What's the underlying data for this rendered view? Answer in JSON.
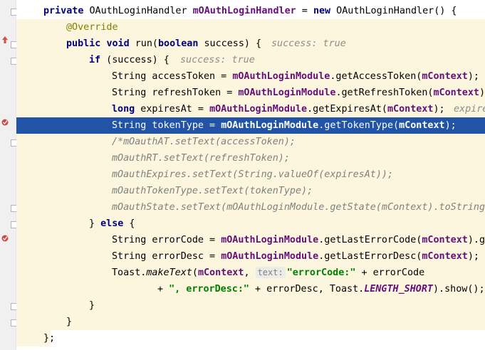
{
  "editor": {
    "lines": [
      {
        "id": 0,
        "segments": [
          {
            "t": "private",
            "c": "kw"
          },
          {
            "t": " OAuthLoginHandler "
          },
          {
            "t": "mOAuthLoginHandler",
            "c": "field"
          },
          {
            "t": " = "
          },
          {
            "t": "new",
            "c": "kw"
          },
          {
            "t": " OAuthLoginHandler() {"
          }
        ]
      },
      {
        "id": 1,
        "segments": [
          {
            "t": "@Override",
            "c": "ann"
          }
        ]
      },
      {
        "id": 2,
        "segments": [
          {
            "t": "public",
            "c": "kw"
          },
          {
            "t": " "
          },
          {
            "t": "void",
            "c": "kw"
          },
          {
            "t": " run("
          },
          {
            "t": "boolean",
            "c": "kw"
          },
          {
            "t": " success) {"
          }
        ]
      },
      {
        "id": 3,
        "segments": [
          {
            "t": "if",
            "c": "kw"
          },
          {
            "t": " (success) {"
          }
        ]
      },
      {
        "id": 4,
        "segments": [
          {
            "t": "String accessToken = "
          },
          {
            "t": "mOAuthLoginModule",
            "c": "field"
          },
          {
            "t": ".getAccessToken("
          },
          {
            "t": "mContext",
            "c": "field"
          },
          {
            "t": ");"
          }
        ]
      },
      {
        "id": 5,
        "segments": [
          {
            "t": "String refreshToken = "
          },
          {
            "t": "mOAuthLoginModule",
            "c": "field"
          },
          {
            "t": ".getRefreshToken("
          },
          {
            "t": "mContext",
            "c": "field"
          },
          {
            "t": ");"
          }
        ]
      },
      {
        "id": 6,
        "segments": [
          {
            "t": "long",
            "c": "kw"
          },
          {
            "t": " expiresAt = "
          },
          {
            "t": "mOAuthLoginModule",
            "c": "field"
          },
          {
            "t": ".getExpiresAt("
          },
          {
            "t": "mContext",
            "c": "field"
          },
          {
            "t": ");"
          }
        ]
      },
      {
        "id": 7,
        "segments": [
          {
            "t": "String tokenType = "
          },
          {
            "t": "mOAuthLoginModule",
            "c": "field"
          },
          {
            "t": ".getTokenType("
          },
          {
            "t": "mContext",
            "c": "field"
          },
          {
            "t": ");"
          }
        ]
      },
      {
        "id": 8,
        "segments": [
          {
            "t": "/*mOauthAT.setText(accessToken);",
            "c": "cmt"
          }
        ]
      },
      {
        "id": 9,
        "segments": [
          {
            "t": "mOauthRT.setText(refreshToken);",
            "c": "cmt"
          }
        ]
      },
      {
        "id": 10,
        "segments": [
          {
            "t": "mOauthExpires.setText(String.valueOf(expiresAt));",
            "c": "cmt"
          }
        ]
      },
      {
        "id": 11,
        "segments": [
          {
            "t": "mOauthTokenType.setText(tokenType);",
            "c": "cmt"
          }
        ]
      },
      {
        "id": 12,
        "segments": [
          {
            "t": "mOauthState.setText(mOAuthLoginModule.getState(mContext).toString(",
            "c": "cmt"
          }
        ]
      },
      {
        "id": 13,
        "segments": [
          {
            "t": "} "
          },
          {
            "t": "else",
            "c": "kw"
          },
          {
            "t": " {"
          }
        ]
      },
      {
        "id": 14,
        "segments": [
          {
            "t": "String errorCode = "
          },
          {
            "t": "mOAuthLoginModule",
            "c": "field"
          },
          {
            "t": ".getLastErrorCode("
          },
          {
            "t": "mContext",
            "c": "field"
          },
          {
            "t": ").ge"
          }
        ]
      },
      {
        "id": 15,
        "segments": [
          {
            "t": "String errorDesc = "
          },
          {
            "t": "mOAuthLoginModule",
            "c": "field"
          },
          {
            "t": ".getLastErrorDesc("
          },
          {
            "t": "mContext",
            "c": "field"
          },
          {
            "t": ");"
          }
        ]
      },
      {
        "id": 16,
        "segments": [
          {
            "t": "Toast."
          },
          {
            "t": "makeText",
            "c": "static-call"
          },
          {
            "t": "("
          },
          {
            "t": "mContext",
            "c": "field"
          },
          {
            "t": ", "
          },
          {
            "t": "text:",
            "c": "param-hint"
          },
          {
            "t": "\"errorCode:\"",
            "c": "str"
          },
          {
            "t": " + errorCode"
          }
        ]
      },
      {
        "id": 17,
        "segments": [
          {
            "t": "+ "
          },
          {
            "t": "\", errorDesc:\"",
            "c": "str"
          },
          {
            "t": " + errorDesc, Toast."
          },
          {
            "t": "LENGTH_SHORT",
            "c": "static-field"
          },
          {
            "t": ").show();"
          }
        ]
      },
      {
        "id": 18,
        "segments": [
          {
            "t": "}"
          }
        ]
      },
      {
        "id": 19,
        "segments": [
          {
            "t": "}"
          }
        ]
      },
      {
        "id": 20,
        "segments": [
          {
            "t": "};"
          }
        ]
      }
    ],
    "inlay_hints": [
      {
        "line": 2,
        "text": "success: true"
      },
      {
        "line": 3,
        "text": "success: true"
      },
      {
        "line": 6,
        "text": "expire"
      }
    ]
  },
  "colors": {
    "selection": "#2154a6",
    "scope_highlight": "#fbf6dd",
    "keyword": "#000080",
    "field": "#660e7a",
    "comment": "#808080",
    "string": "#008000",
    "annotation": "#808000"
  }
}
